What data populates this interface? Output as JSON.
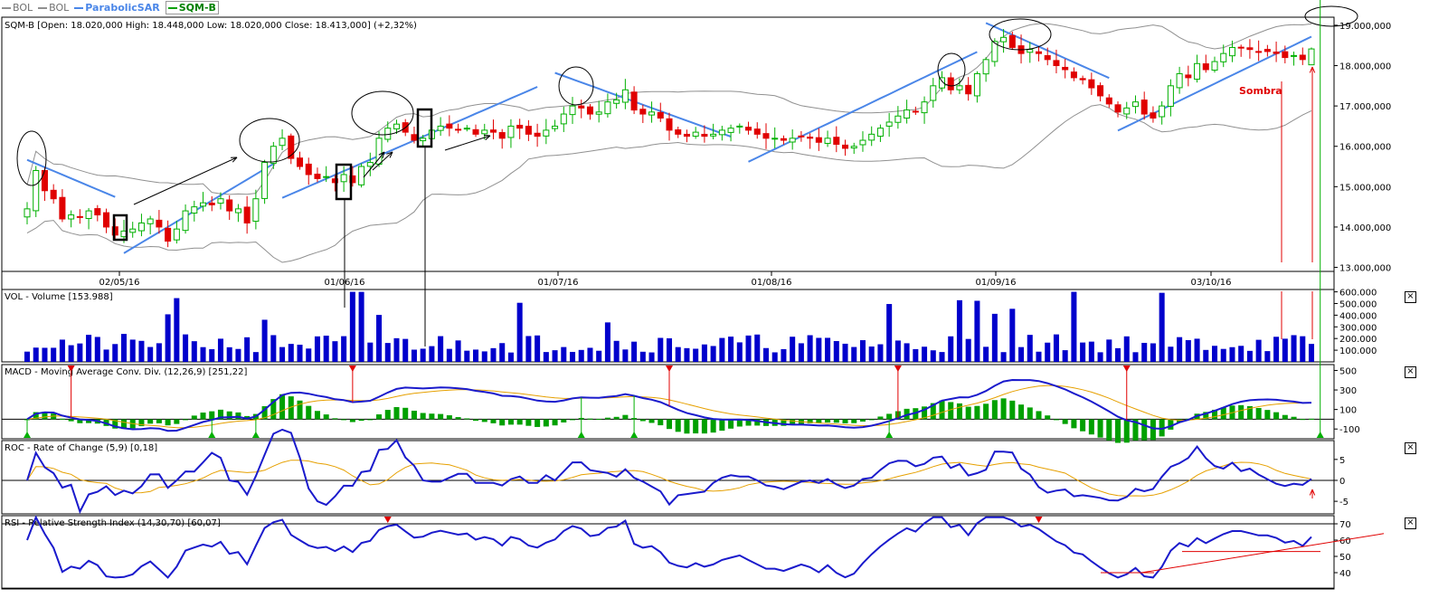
{
  "legend": [
    {
      "label": "BOL",
      "color": "#909090"
    },
    {
      "label": "BOL",
      "color": "#909090"
    },
    {
      "label": "ParabolicSAR",
      "color": "#4a86e8"
    },
    {
      "label": "SQM-B",
      "color": "#00a000"
    }
  ],
  "colors": {
    "up_candle": "#00b000",
    "down_candle": "#e00000",
    "bollinger": "#909090",
    "sar": "#4a86e8",
    "volume": "#0000cc",
    "macd_line": "#1a1acc",
    "signal_line": "#e6a000",
    "histogram": "#00a000",
    "annotation": "#e00000"
  },
  "panels": {
    "price": {
      "title": "SQM-B [Open: 18.020,000  High: 18.448,000  Low: 18.020,000  Close: 18.413,000] (+2,32%)"
    },
    "volume": {
      "title": "VOL - Volume [153.988]"
    },
    "macd": {
      "title": "MACD - Moving Average Conv. Div. (12,26,9) [251,22]"
    },
    "roc": {
      "title": "ROC - Rate of Change (5,9) [0,18]"
    },
    "rsi": {
      "title": "RSI - Relative Strength Index (14,30,70) [60,07]"
    }
  },
  "annotations": {
    "sombra": "Sombra"
  },
  "chart_data": [
    {
      "type": "candlestick",
      "title": "SQM-B [Open: 18.020,000  High: 18.448,000  Low: 18.020,000  Close: 18.413,000] (+2,32%)",
      "x_ticks": [
        "02/05/16",
        "01/06/16",
        "01/07/16",
        "01/08/16",
        "01/09/16",
        "03/10/16"
      ],
      "y_ticks": [
        "19.000,000",
        "18.000,000",
        "17.000,000",
        "16.000,000",
        "15.000,000",
        "14.000,000",
        "13.000,000"
      ],
      "ylim": [
        12900,
        19200
      ],
      "closes": [
        14450,
        15400,
        14900,
        14700,
        14200,
        14300,
        14250,
        14400,
        14300,
        14000,
        13800,
        13900,
        13950,
        14100,
        14200,
        14000,
        13650,
        13950,
        14400,
        14500,
        14600,
        14550,
        14700,
        14400,
        14450,
        14100,
        14700,
        15600,
        16000,
        16200,
        15700,
        15500,
        15300,
        15200,
        15250,
        15100,
        15300,
        15100,
        15500,
        15600,
        16200,
        16450,
        16550,
        16350,
        16150,
        16200,
        16400,
        16500,
        16450,
        16400,
        16450,
        16300,
        16400,
        16350,
        16200,
        16500,
        16450,
        16300,
        16250,
        16400,
        16500,
        16800,
        17000,
        16950,
        16800,
        16850,
        17100,
        17150,
        17400,
        16900,
        16800,
        16850,
        16700,
        16400,
        16300,
        16250,
        16350,
        16250,
        16300,
        16400,
        16450,
        16500,
        16400,
        16300,
        16200,
        16200,
        16150,
        16200,
        16250,
        16200,
        16100,
        16200,
        16050,
        15950,
        16000,
        16150,
        16300,
        16450,
        16600,
        16750,
        16900,
        16850,
        17100,
        17500,
        17700,
        17400,
        17500,
        17300,
        17800,
        18150,
        18600,
        18700,
        18450,
        18300,
        18400,
        18300,
        18150,
        18000,
        17900,
        17700,
        17650,
        17450,
        17250,
        17050,
        16850,
        16950,
        17100,
        16800,
        16700,
        17000,
        17500,
        17800,
        17700,
        18050,
        17900,
        18100,
        18300,
        18450,
        18450,
        18400,
        18350,
        18350,
        18300,
        18200,
        18250,
        18150,
        18413
      ],
      "ohlc_note": "last candle open 18020 high 18448 low 18020 close 18413"
    },
    {
      "type": "bar",
      "title": "VOL - Volume [153.988]",
      "y_ticks": [
        "600.000",
        "500.000",
        "400.000",
        "300.000",
        "200.000",
        "100.000"
      ],
      "ylim": [
        0,
        620000
      ]
    },
    {
      "type": "line",
      "title": "MACD - Moving Average Conv. Div. (12,26,9) [251,22]",
      "y_ticks": [
        "500",
        "300",
        "100",
        "-100"
      ],
      "ylim": [
        -200,
        560
      ]
    },
    {
      "type": "line",
      "title": "ROC - Rate of Change (5,9) [0,18]",
      "y_ticks": [
        "5",
        "0",
        "-5"
      ],
      "ylim": [
        -8,
        9.5
      ]
    },
    {
      "type": "line",
      "title": "RSI - Relative Strength Index (14,30,70) [60,07]",
      "y_ticks": [
        "70",
        "60",
        "50",
        "40"
      ],
      "ylim": [
        30,
        75
      ]
    }
  ]
}
